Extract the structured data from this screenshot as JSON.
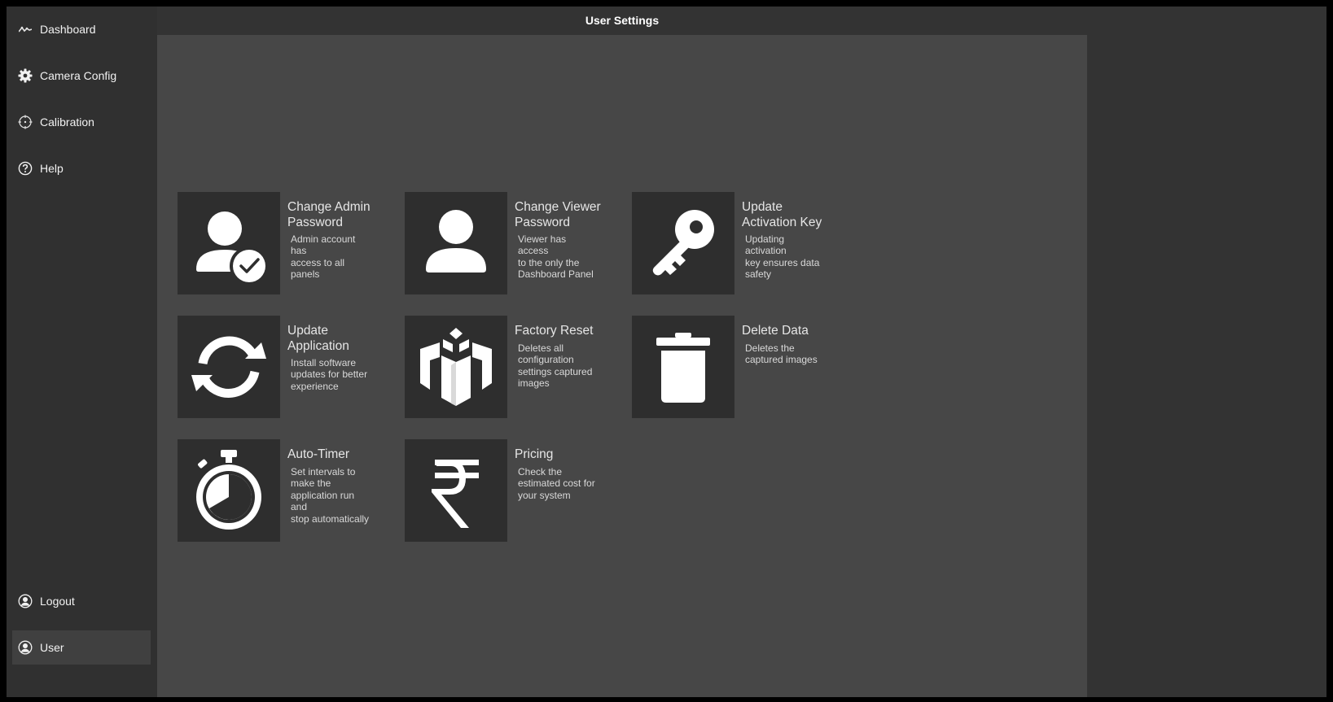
{
  "window": {
    "title": "User Settings"
  },
  "sidebar": {
    "items": [
      {
        "label": "Dashboard",
        "icon": "activity-icon"
      },
      {
        "label": "Camera Config",
        "icon": "gear-icon"
      },
      {
        "label": "Calibration",
        "icon": "crosshair-icon"
      },
      {
        "label": "Help",
        "icon": "help-circle-icon"
      }
    ],
    "bottom": [
      {
        "label": "Logout",
        "icon": "user-circle-icon"
      },
      {
        "label": "User",
        "icon": "user-circle-icon",
        "active": true
      }
    ]
  },
  "tiles": [
    {
      "title": "Change Admin\nPassword",
      "desc": "Admin account\nhas\naccess to all\npanels",
      "icon": "admin-user-check-icon"
    },
    {
      "title": "Change Viewer\nPassword",
      "desc": "Viewer has\naccess\nto the only the\nDashboard Panel",
      "icon": "user-icon"
    },
    {
      "title": "Update\nActivation Key",
      "desc": "Updating\nactivation\nkey ensures data\nsafety",
      "icon": "key-icon"
    },
    {
      "title": "Update\nApplication",
      "desc": "Install software\nupdates for better\nexperience",
      "icon": "refresh-icon"
    },
    {
      "title": "Factory Reset",
      "desc": "Deletes all\nconfiguration\nsettings captured\nimages",
      "icon": "factory-reset-icon"
    },
    {
      "title": "Delete Data",
      "desc": "Deletes the\ncaptured images",
      "icon": "trash-icon"
    },
    {
      "title": "Auto-Timer",
      "desc": "Set intervals to\nmake the\napplication run\nand\nstop automatically",
      "icon": "stopwatch-icon"
    },
    {
      "title": "Pricing",
      "desc": "Check the\nestimated cost for\nyour system",
      "icon": "rupee-icon"
    }
  ],
  "colors": {
    "background": "#333333",
    "sidebar": "#303030",
    "panel": "#474747",
    "tile_icon_bg": "#2e2e2e",
    "active_item": "#404040"
  }
}
